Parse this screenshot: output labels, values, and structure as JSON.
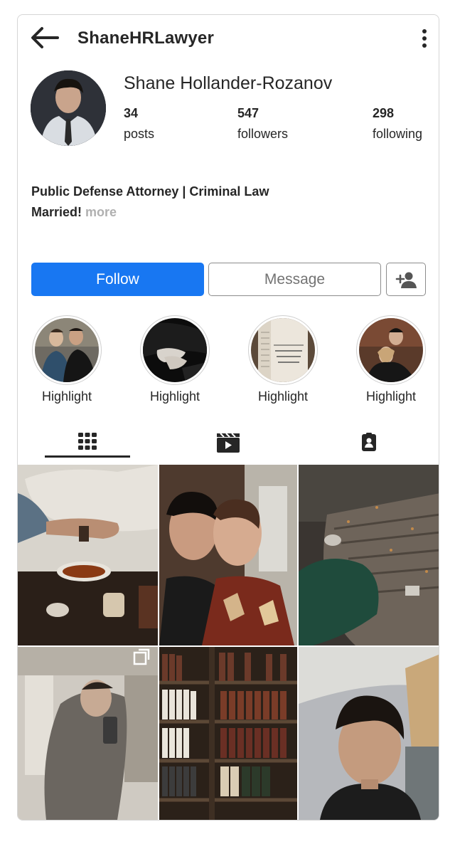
{
  "header": {
    "username": "ShaneHRLawyer",
    "back_icon": "arrow-left-icon",
    "menu_icon": "more-vertical-icon"
  },
  "profile": {
    "full_name": "Shane Hollander-Rozanov",
    "stats": {
      "posts_count": "34",
      "posts_label": "posts",
      "followers_count": "547",
      "followers_label": "followers",
      "following_count": "298",
      "following_label": "following"
    },
    "bio": {
      "line1": "Public Defense Attorney | Criminal Law",
      "line2": "Married!",
      "more": "more"
    }
  },
  "actions": {
    "follow_label": "Follow",
    "message_label": "Message",
    "add_user_icon": "add-person-icon"
  },
  "highlights": [
    {
      "label": "Highlight"
    },
    {
      "label": "Highlight"
    },
    {
      "label": "Highlight"
    },
    {
      "label": "Highlight"
    }
  ],
  "tabs": [
    {
      "icon": "grid-icon",
      "active": true
    },
    {
      "icon": "reels-icon",
      "active": false
    },
    {
      "icon": "tagged-icon",
      "active": false
    }
  ],
  "colors": {
    "accent": "#1877f2",
    "text": "#262626",
    "muted": "#b0b0b0"
  }
}
